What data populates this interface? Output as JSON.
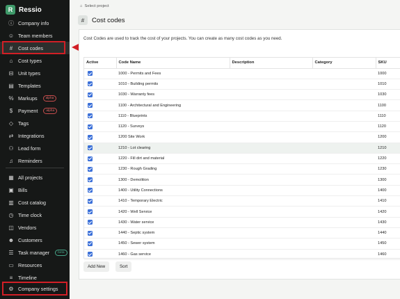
{
  "app": {
    "name": "Ressio",
    "logo_letter": "R"
  },
  "sidebar": {
    "group1": [
      {
        "label": "Company info",
        "icon": "info-icon",
        "glyph": "ⓘ"
      },
      {
        "label": "Team members",
        "icon": "people-icon",
        "glyph": "☺"
      },
      {
        "label": "Cost codes",
        "icon": "hash-icon",
        "glyph": "#",
        "active": true
      },
      {
        "label": "Cost types",
        "icon": "tag-icon",
        "glyph": "⌂"
      },
      {
        "label": "Unit types",
        "icon": "ruler-icon",
        "glyph": "⊟"
      },
      {
        "label": "Templates",
        "icon": "template-icon",
        "glyph": "▤"
      },
      {
        "label": "Markups",
        "icon": "percent-icon",
        "glyph": "%",
        "badge": "alpha"
      },
      {
        "label": "Payment",
        "icon": "dollar-icon",
        "glyph": "$",
        "badge": "alpha"
      },
      {
        "label": "Tags",
        "icon": "tag-icon",
        "glyph": "◇"
      },
      {
        "label": "Integrations",
        "icon": "integrations-icon",
        "glyph": "⇄"
      },
      {
        "label": "Lead form",
        "icon": "user-plus-icon",
        "glyph": "⚇"
      },
      {
        "label": "Reminders",
        "icon": "bell-icon",
        "glyph": "♫"
      }
    ],
    "group2": [
      {
        "label": "All projects",
        "icon": "grid-icon",
        "glyph": "▦"
      },
      {
        "label": "Bills",
        "icon": "bill-icon",
        "glyph": "▣"
      },
      {
        "label": "Cost catalog",
        "icon": "catalog-icon",
        "glyph": "▥"
      },
      {
        "label": "Time clock",
        "icon": "clock-icon",
        "glyph": "◷"
      },
      {
        "label": "Vendors",
        "icon": "vendor-icon",
        "glyph": "◫"
      },
      {
        "label": "Customers",
        "icon": "customer-icon",
        "glyph": "☻"
      },
      {
        "label": "Task manager",
        "icon": "task-icon",
        "glyph": "☰",
        "badge": "beta"
      },
      {
        "label": "Resources",
        "icon": "resources-icon",
        "glyph": "▭"
      },
      {
        "label": "Timeline",
        "icon": "timeline-icon",
        "glyph": "≡"
      }
    ],
    "footer": {
      "label": "Company settings",
      "icon": "gear-icon",
      "glyph": "⚙"
    }
  },
  "breadcrumb": {
    "label": "Select project",
    "icon": "home-icon"
  },
  "page": {
    "title": "Cost codes",
    "description": "Cost Codes are used to track the cost of your projects. You can create as many cost codes as you need."
  },
  "table": {
    "columns": [
      "Active",
      "Code Name",
      "Description",
      "Category",
      "SKU"
    ],
    "rows": [
      {
        "active": true,
        "name": "1000 - Permits and Fees",
        "description": "",
        "category": "",
        "sku": "1000"
      },
      {
        "active": true,
        "name": "1010 - Building permits",
        "description": "",
        "category": "",
        "sku": "1010"
      },
      {
        "active": true,
        "name": "1030 - Warranty fees",
        "description": "",
        "category": "",
        "sku": "1030"
      },
      {
        "active": true,
        "name": "1100 - Architectural and Engineering",
        "description": "",
        "category": "",
        "sku": "1100"
      },
      {
        "active": true,
        "name": "1110 - Blueprints",
        "description": "",
        "category": "",
        "sku": "1110"
      },
      {
        "active": true,
        "name": "1120 - Surveys",
        "description": "",
        "category": "",
        "sku": "1120"
      },
      {
        "active": true,
        "name": "1200 Site Work",
        "description": "",
        "category": "",
        "sku": "1200"
      },
      {
        "active": true,
        "name": "1210 - Lot clearing",
        "description": "",
        "category": "",
        "sku": "1210",
        "hover": true
      },
      {
        "active": true,
        "name": "1220 - Fill dirt and material",
        "description": "",
        "category": "",
        "sku": "1220"
      },
      {
        "active": true,
        "name": "1230 - Rough Grading",
        "description": "",
        "category": "",
        "sku": "1230"
      },
      {
        "active": true,
        "name": "1300 - Demolition",
        "description": "",
        "category": "",
        "sku": "1300"
      },
      {
        "active": true,
        "name": "1400 - Utility Connections",
        "description": "",
        "category": "",
        "sku": "1400"
      },
      {
        "active": true,
        "name": "1410 - Temporary Electric",
        "description": "",
        "category": "",
        "sku": "1410"
      },
      {
        "active": true,
        "name": "1420 - Well Service",
        "description": "",
        "category": "",
        "sku": "1420"
      },
      {
        "active": true,
        "name": "1430 - Water service",
        "description": "",
        "category": "",
        "sku": "1430"
      },
      {
        "active": true,
        "name": "1440 - Septic system",
        "description": "",
        "category": "",
        "sku": "1440"
      },
      {
        "active": true,
        "name": "1450 - Sewer system",
        "description": "",
        "category": "",
        "sku": "1450"
      },
      {
        "active": true,
        "name": "1460 - Gas service",
        "description": "",
        "category": "",
        "sku": "1460"
      }
    ]
  },
  "buttons": {
    "add_new": "Add New",
    "sort": "Sort"
  },
  "colors": {
    "sidebar_bg": "#161817",
    "accent": "#3f9a6a",
    "checkbox": "#3a6fd8",
    "annotation": "#d21f26"
  }
}
